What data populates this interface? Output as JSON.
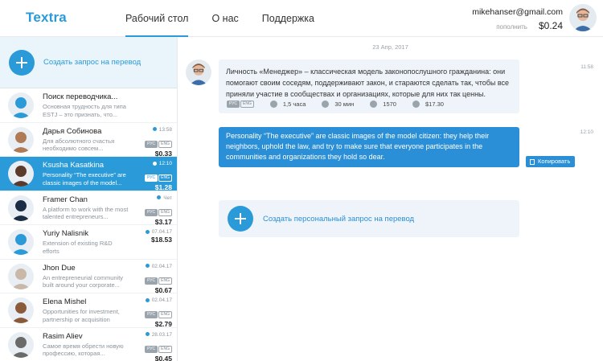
{
  "brand": {
    "logo": "Textra"
  },
  "nav": {
    "items": [
      "Рабочий стол",
      "О нас",
      "Поддержка"
    ],
    "active": 0
  },
  "user": {
    "email": "mikehanser@gmail.com",
    "topup_label": "пополнить",
    "balance": "$0.24"
  },
  "sidebar": {
    "create_label": "Создать запрос на перевод",
    "chats": [
      {
        "name": "Поиск переводчика...",
        "preview": "Основная трудность для типа ESTJ – это признать, что...",
        "time": "",
        "langs": [],
        "price": "",
        "active": false,
        "avatar_color": "#2a9ad8"
      },
      {
        "name": "Дарья Собинова",
        "preview": "Для абсолютного счастья необходимо совсем...",
        "time": "13:58",
        "langs": [
          "РУС",
          "ENG"
        ],
        "price": "$0.33",
        "active": false,
        "avatar_color": "#b07a55"
      },
      {
        "name": "Ksusha Kasatkina",
        "preview": "Personality “The  executive” are classic images of the model...",
        "time": "12:10",
        "langs": [
          "РУС",
          "ENG"
        ],
        "price": "$1.28",
        "active": true,
        "avatar_color": "#5a3a2a"
      },
      {
        "name": "Framer Chan",
        "preview": "A platform to work with the most talented entrepreneurs...",
        "time": "Чет",
        "langs": [
          "РУС",
          "ENG"
        ],
        "price": "$3.17",
        "active": false,
        "avatar_color": "#1b2d44"
      },
      {
        "name": "Yuriy Nalisnik",
        "preview": "Extension of existing R&D efforts",
        "time": "07.04.17",
        "langs": [],
        "price": "$18.53",
        "active": false,
        "avatar_color": "#2a9ad8"
      },
      {
        "name": "Jhon Due",
        "preview": "An entrepreneurial community built around your corporate...",
        "time": "02.04.17",
        "langs": [
          "РУС",
          "ENG"
        ],
        "price": "$0.67",
        "active": false,
        "avatar_color": "#c9b8a8"
      },
      {
        "name": "Elena Mishel",
        "preview": "Opportunities for investment, partnership or acquisition",
        "time": "02.04.17",
        "langs": [
          "РУС",
          "ENG"
        ],
        "price": "$2.79",
        "active": false,
        "avatar_color": "#8a5a3a"
      },
      {
        "name": "Rasim Aliev",
        "preview": "Самое время обрести новую профессию, которая...",
        "time": "28.03.17",
        "langs": [
          "РУС",
          "ENG"
        ],
        "price": "$0.45",
        "active": false,
        "avatar_color": "#6a6a6a"
      }
    ]
  },
  "conversation": {
    "date": "23 Апр, 2017",
    "incoming": {
      "text": "Личность «Менеджер» – классическая модель законопослушного гражданина: они помогают своим соседям, поддерживают закон, и стараются сделать так, чтобы все приняли участие в сообществах и организациях, которые для них так ценны.",
      "time": "11:58",
      "langs": [
        "РУС",
        "ENG"
      ],
      "duration": "1,5 часа",
      "eta": "30 мин",
      "chars": "1570",
      "cost": "$17.30"
    },
    "outgoing": {
      "text": "Personality “The  executive” are classic images of the model citizen: they help their neighbors, uphold the law, and try to make sure that everyone participates in the communities and organizations they hold so dear.",
      "time": "12:10"
    },
    "copy_label": "Копировать",
    "create_personal_label": "Создать персональный запрос на перевод"
  }
}
